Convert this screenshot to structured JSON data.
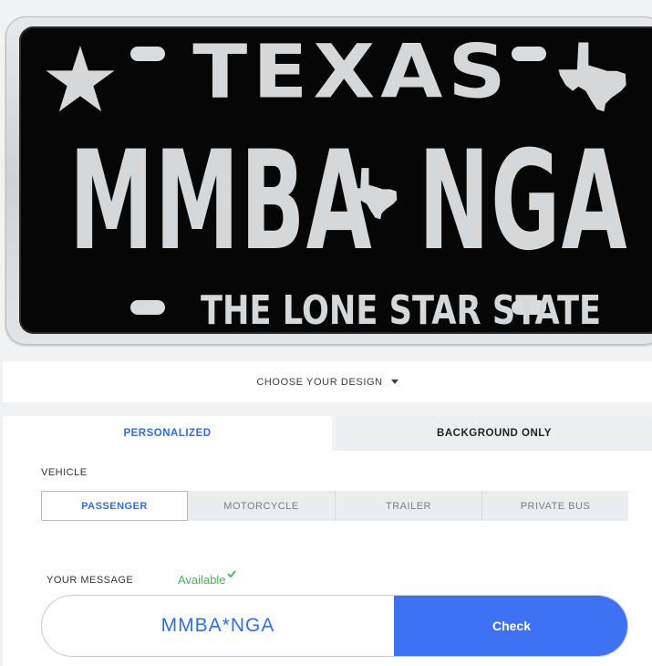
{
  "plate": {
    "state": "TEXAS",
    "number_left": "MMBA",
    "number_right": "NGA",
    "tagline": "THE LONE STAR STATE",
    "background_color": "#060606",
    "text_color": "#d4d8db",
    "icons": [
      "star-icon",
      "texas-shape-icon"
    ]
  },
  "design_chooser": {
    "label": "CHOOSE YOUR DESIGN",
    "icon": "caret-down-icon"
  },
  "tabs": [
    {
      "label": "PERSONALIZED",
      "active": true
    },
    {
      "label": "BACKGROUND ONLY",
      "active": false
    }
  ],
  "vehicle": {
    "label": "VEHICLE",
    "options": [
      {
        "label": "PASSENGER",
        "selected": true
      },
      {
        "label": "MOTORCYCLE",
        "selected": false
      },
      {
        "label": "TRAILER",
        "selected": false
      },
      {
        "label": "PRIVATE BUS",
        "selected": false
      }
    ]
  },
  "message": {
    "label": "YOUR MESSAGE",
    "status": "Available",
    "status_icon": "checkmark-icon",
    "value": "MMBA*NGA",
    "check_label": "Check"
  },
  "colors": {
    "accent": "#2f6fe0",
    "button": "#3d72f5",
    "available": "#3fb950"
  }
}
